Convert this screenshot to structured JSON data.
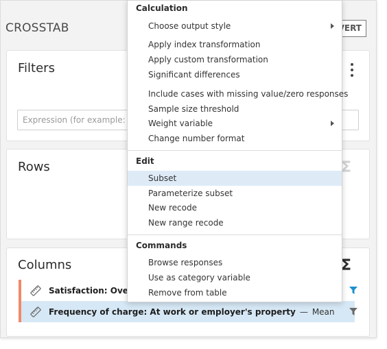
{
  "panel": {
    "title": "CROSSTAB",
    "invert_label": "VERT"
  },
  "filters": {
    "title": "Filters",
    "expression_placeholder": "Expression (for example: 'A"
  },
  "rows": {
    "title": "Rows"
  },
  "columns": {
    "title": "Columns",
    "variables": [
      {
        "label": "Satisfaction: Overall r",
        "separator": "",
        "stat": ""
      },
      {
        "label": "Frequency of charge: At work or employer's property",
        "separator": "—",
        "stat": "Mean"
      }
    ]
  },
  "menu": {
    "calculation": {
      "header": "Calculation",
      "items": [
        "Choose output style",
        "Apply index transformation",
        "Apply custom transformation",
        "Significant differences",
        "Include cases with missing value/zero responses",
        "Sample size threshold",
        "Weight variable",
        "Change number format"
      ]
    },
    "edit": {
      "header": "Edit",
      "items": [
        "Subset",
        "Parameterize subset",
        "New recode",
        "New range recode"
      ]
    },
    "commands": {
      "header": "Commands",
      "items": [
        "Browse responses",
        "Use as category variable",
        "Remove from table"
      ]
    }
  },
  "icons": {
    "sigma": "Σ",
    "kebab": "more-vertical-icon",
    "ruler": "ruler-icon",
    "funnel": "filter-funnel-icon",
    "submenu": "chevron-right-icon"
  },
  "colors": {
    "accent_bar": "#f0896a",
    "highlight_row": "#d6e8f5",
    "menu_highlight": "#deebf7",
    "funnel_active": "#1a8fd1"
  }
}
